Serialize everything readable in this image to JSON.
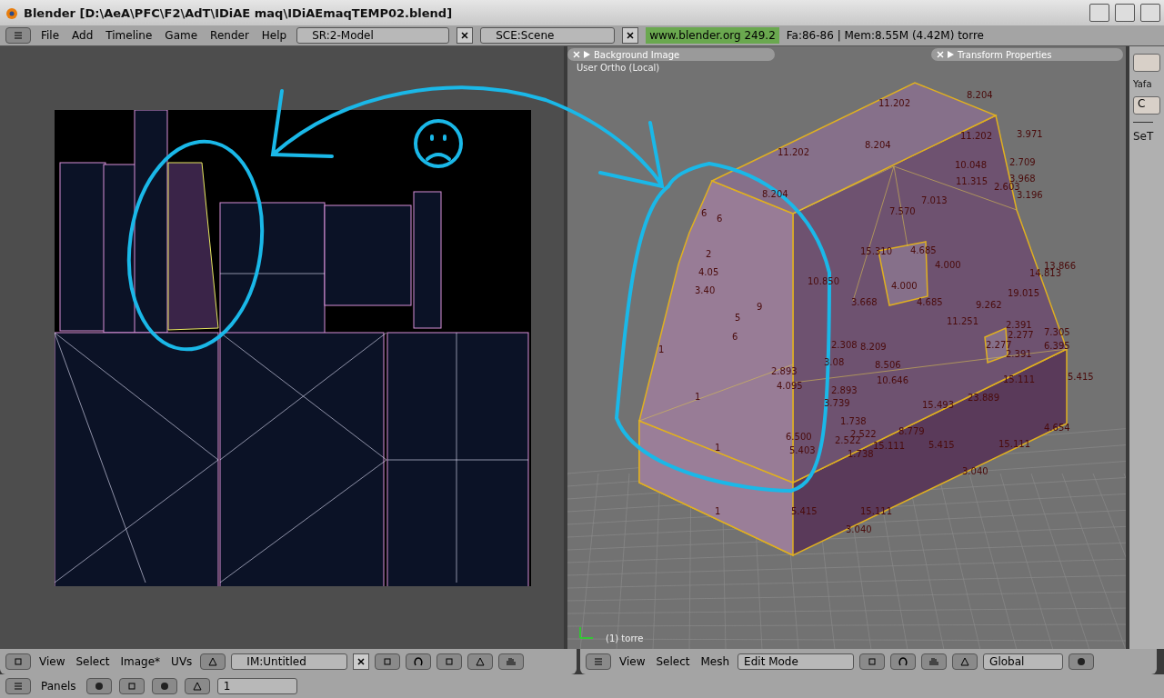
{
  "window": {
    "title": "Blender [D:\\AeA\\PFC\\F2\\AdT\\IDiAE maq\\IDiAEmaqTEMP02.blend]"
  },
  "menu_bar": {
    "menus": [
      "File",
      "Add",
      "Timeline",
      "Game",
      "Render",
      "Help"
    ],
    "screen_field": "SR:2-Model",
    "scene_field": "SCE:Scene",
    "version": "www.blender.org 249.2",
    "stats": "Fa:86-86 | Mem:8.55M (4.42M) torre"
  },
  "uv_editor": {
    "header": {
      "menus": [
        "View",
        "Select",
        "Image*",
        "UVs"
      ],
      "image_field": "IM:Untitled"
    }
  },
  "viewport": {
    "panels": [
      "Background Image",
      "Transform Properties"
    ],
    "view_name": "User Ortho (Local)",
    "object_label": "(1) torre",
    "edge_lengths": [
      "11.202",
      "8.204",
      "11.202",
      "8.204",
      "11.202",
      "3.971",
      "10.048",
      "2.709",
      "11.315",
      "3.968",
      "2.603",
      "3.196",
      "8.204",
      "7.013",
      "7.570",
      "6",
      "6",
      "2",
      "15.310",
      "4.685",
      "4.000",
      "13.866",
      "14.813",
      "4.05",
      "3.40",
      "10.850",
      "9",
      "4.000",
      "5",
      "3.668",
      "4.685",
      "19.015",
      "9.262",
      "6",
      "1",
      "11.251",
      "2.391",
      "2.277",
      "7.305",
      "2.308",
      "8.209",
      "2.277",
      "6.395",
      "2.391",
      "3.08",
      "8.506",
      "2.893",
      "1",
      "4.095",
      "2.893",
      "10.646",
      "15.111",
      "5.415",
      "3.739",
      "15.493",
      "23.889",
      "1.738",
      "4.654",
      "6.500",
      "2.522",
      "8.779",
      "2.522",
      "15.111",
      "5.415",
      "15.111",
      "5.403",
      "1.738",
      "1",
      "3.040",
      "5.415",
      "15.111",
      "3.040",
      "1"
    ],
    "header": {
      "menus": [
        "View",
        "Select",
        "Mesh"
      ],
      "mode": "Edit Mode",
      "orientation": "Global"
    }
  },
  "buttons_header": {
    "menus": [
      "Panels"
    ],
    "page": "1"
  },
  "side_panel": {
    "label": "Yafa",
    "button_label": "C",
    "heading": "SeT"
  }
}
